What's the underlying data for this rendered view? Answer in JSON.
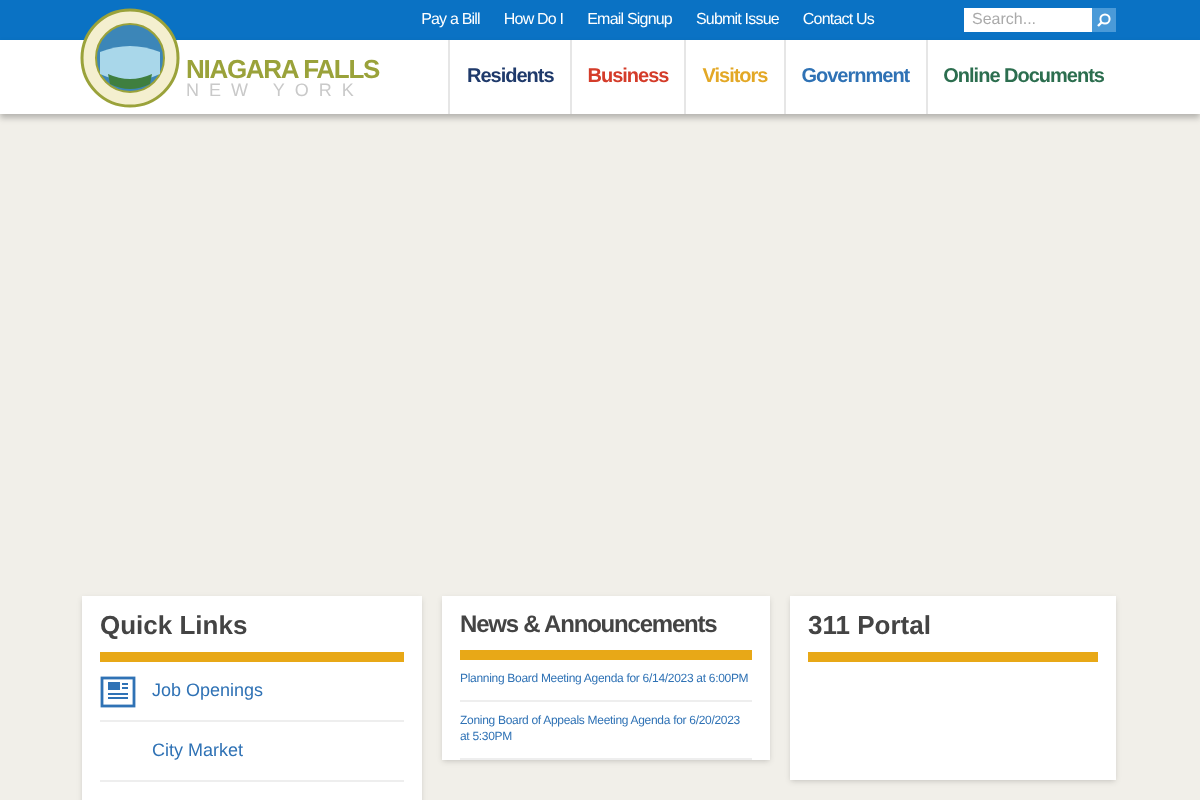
{
  "top_links": [
    "Pay a Bill",
    "How Do I",
    "Email Signup",
    "Submit Issue",
    "Contact Us"
  ],
  "search": {
    "placeholder": "Search..."
  },
  "logo": {
    "title": "NIAGARA FALLS",
    "subtitle": "NEW YORK"
  },
  "nav": [
    {
      "label": "Residents",
      "color": "#1f3a6b"
    },
    {
      "label": "Business",
      "color": "#d43c2a"
    },
    {
      "label": "Visitors",
      "color": "#e3a826"
    },
    {
      "label": "Government",
      "color": "#2f72b5"
    },
    {
      "label": "Online Documents",
      "color": "#2c6e4f"
    }
  ],
  "quick_links": {
    "title": "Quick Links",
    "items": [
      {
        "label": "Job Openings",
        "kind": "jobs"
      },
      {
        "label": "City Market",
        "kind": "none"
      },
      {
        "kind": "partial"
      }
    ]
  },
  "news": {
    "title": "News & Announcements",
    "items": [
      "Planning Board Meeting Agenda for 6/14/2023 at 6:00PM",
      "Zoning Board of Appeals Meeting Agenda for 6/20/2023 at 5:30PM"
    ]
  },
  "portal": {
    "title": "311 Portal"
  }
}
